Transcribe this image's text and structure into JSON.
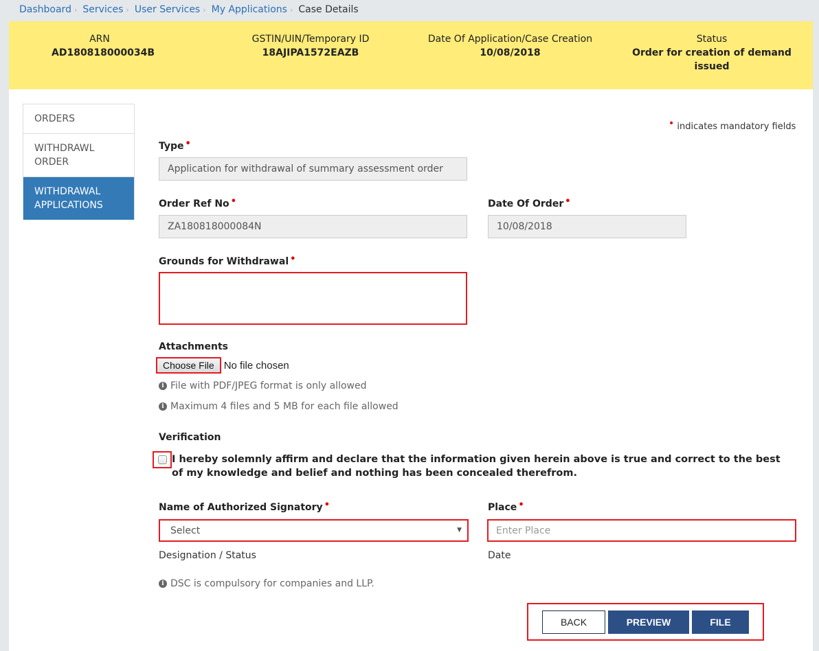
{
  "breadcrumb": {
    "items": [
      "Dashboard",
      "Services",
      "User Services",
      "My Applications"
    ],
    "current": "Case Details"
  },
  "case_header": {
    "arn_label": "ARN",
    "arn_value": "AD180818000034B",
    "gstin_label": "GSTIN/UIN/Temporary ID",
    "gstin_value": "18AJIPA1572EAZB",
    "date_label": "Date Of Application/Case Creation",
    "date_value": "10/08/2018",
    "status_label": "Status",
    "status_value_line1": "Order for creation of demand",
    "status_value_line2": "issued"
  },
  "sidebar": {
    "items": [
      {
        "label": "ORDERS",
        "active": false
      },
      {
        "label_line1": "WITHDRAWL",
        "label_line2": "ORDER",
        "active": false
      },
      {
        "label_line1": "WITHDRAWAL",
        "label_line2": "APPLICATIONS",
        "active": true
      }
    ]
  },
  "form": {
    "mandatory_note": "indicates mandatory fields",
    "required_marker": "•",
    "type_label": "Type",
    "type_value": "Application for withdrawal of summary assessment order",
    "order_ref_label": "Order Ref No",
    "order_ref_value": "ZA180818000084N",
    "date_of_order_label": "Date Of Order",
    "date_of_order_value": "10/08/2018",
    "grounds_label": "Grounds for Withdrawal",
    "grounds_value": "",
    "attachments_label": "Attachments",
    "choose_file_label": "Choose File",
    "no_file_text": "No file chosen",
    "hint_format": "File with PDF/JPEG format is only allowed",
    "hint_size": "Maximum 4 files and 5 MB for each file allowed",
    "verification_label": "Verification",
    "verification_checked": false,
    "verification_text": "I hereby solemnly affirm and declare that the information given herein above is true and correct to the best of my knowledge and belief and nothing has been concealed therefrom.",
    "signatory_label": "Name of Authorized Signatory",
    "signatory_selected": "Select",
    "place_label": "Place",
    "place_placeholder": "Enter Place",
    "place_value": "",
    "designation_label": "Designation / Status",
    "date_label": "Date",
    "dsc_hint": "DSC is compulsory for companies and LLP."
  },
  "actions": {
    "back_label": "BACK",
    "preview_label": "PREVIEW",
    "file_label": "FILE"
  },
  "colors": {
    "header_band": "#ffec79",
    "active_nav": "#337ab7",
    "primary_button": "#2c4f86",
    "highlight_box": "#e31b23",
    "required_dot": "#e00000",
    "link": "#2c6fb5"
  }
}
